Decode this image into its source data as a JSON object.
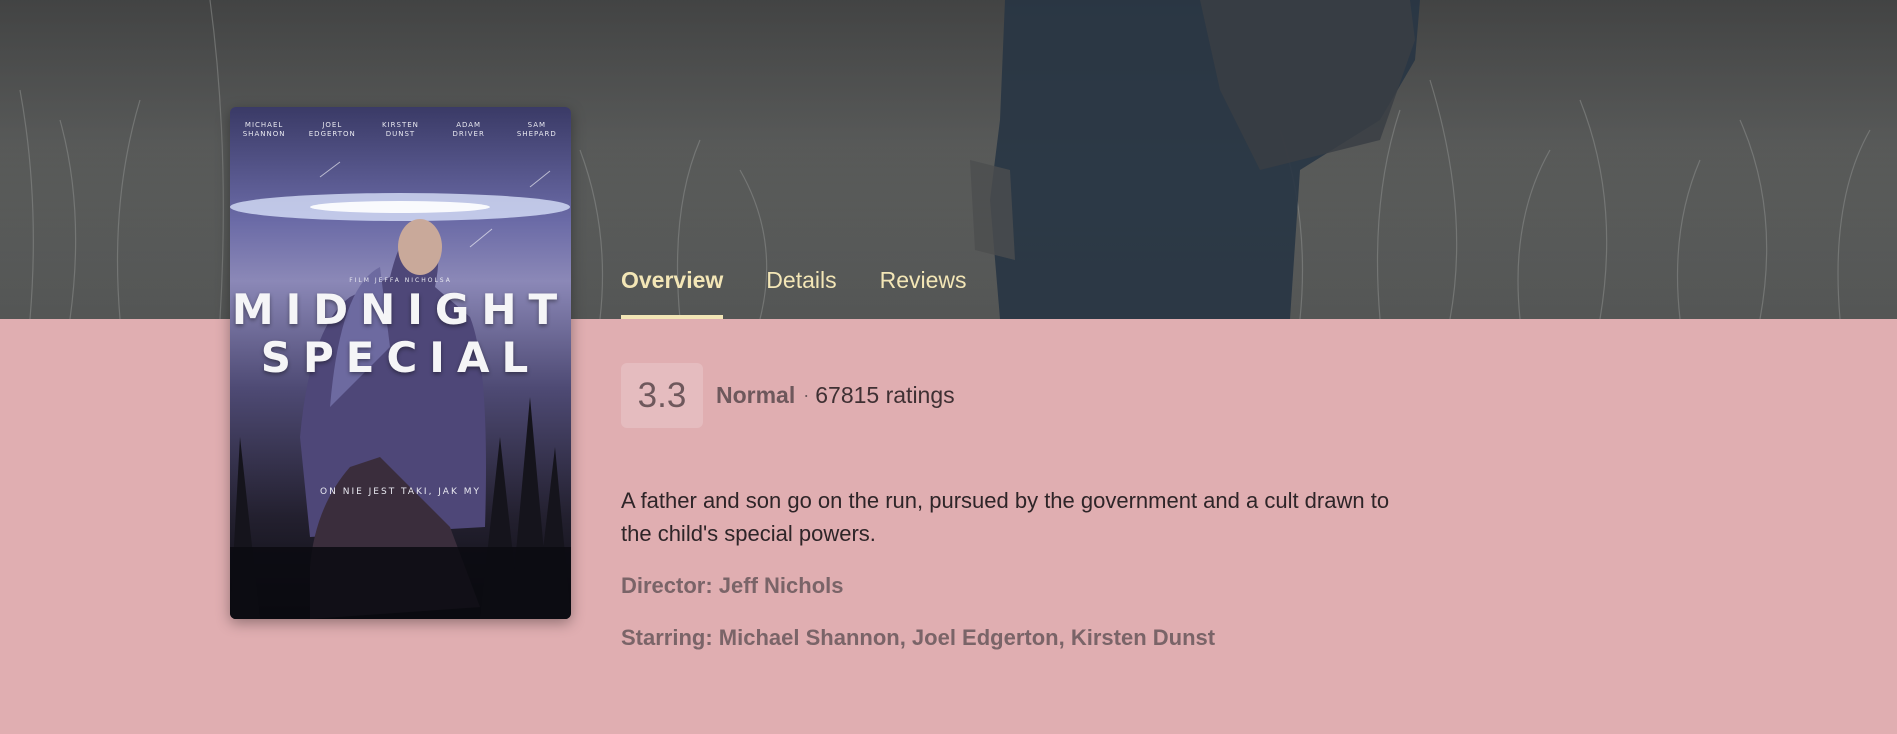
{
  "tabs": [
    {
      "label": "Overview",
      "active": true
    },
    {
      "label": "Details",
      "active": false
    },
    {
      "label": "Reviews",
      "active": false
    }
  ],
  "rating": {
    "score": "3.3",
    "label": "Normal",
    "separator": "·",
    "count": "67815 ratings"
  },
  "overview": "A father and son go on the run, pursued by the government and a cult drawn to the child's special powers.",
  "director": "Director: Jeff Nichols",
  "starring": "Starring: Michael Shannon, Joel Edgerton, Kirsten Dunst",
  "poster": {
    "title_line1": "MIDNIGHT",
    "title_line2": "SPECIAL",
    "cast": [
      "MICHAEL SHANNON",
      "JOEL EDGERTON",
      "KIRSTEN DUNST",
      "ADAM DRIVER",
      "SAM SHEPARD"
    ],
    "credit": "FILM JEFFA NICHOLSA",
    "tagline": "ON NIE JEST TAKI, JAK MY"
  },
  "colors": {
    "background": "#e0aeb1",
    "tab_text": "#f3e6b6",
    "muted_text": "#7a6468"
  }
}
